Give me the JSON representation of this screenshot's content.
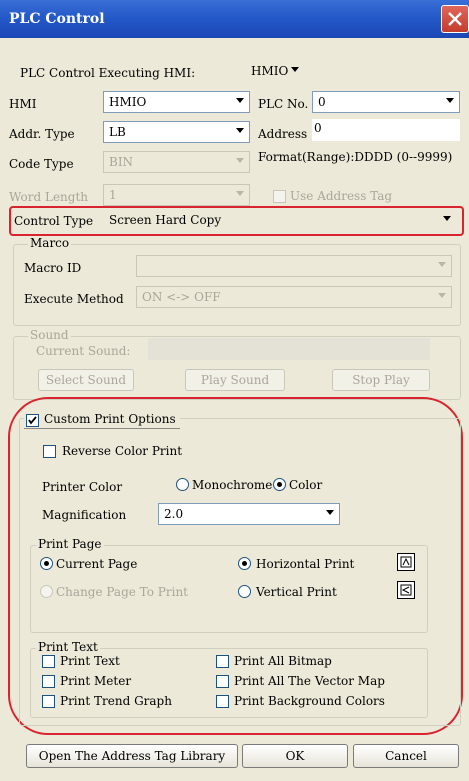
{
  "window": {
    "title": "PLC Control"
  },
  "executing": {
    "label": "PLC Control Executing HMI:",
    "value": "HMIO"
  },
  "hmi": {
    "label": "HMI",
    "value": "HMIO"
  },
  "plc_no": {
    "label": "PLC No.",
    "value": "0"
  },
  "addr_type": {
    "label": "Addr. Type",
    "value": "LB"
  },
  "address": {
    "label": "Address",
    "value": "0"
  },
  "code_type": {
    "label": "Code Type",
    "value": "BIN"
  },
  "format": {
    "text": "Format(Range):DDDD (0--9999)"
  },
  "word_length": {
    "label": "Word Length",
    "value": "1"
  },
  "use_address_tag": {
    "label": "Use Address Tag",
    "checked": false
  },
  "control_type": {
    "label": "Control Type",
    "value": "Screen Hard Copy"
  },
  "marco": {
    "legend": "Marco",
    "macro_id_label": "Macro ID",
    "macro_id_value": "",
    "execute_method_label": "Execute Method",
    "execute_method_value": "ON <-> OFF"
  },
  "sound": {
    "legend": "Sound",
    "current_label": "Current Sound:",
    "select_label": "Select Sound",
    "play_label": "Play Sound",
    "stop_label": "Stop Play"
  },
  "print_options": {
    "label": "Custom Print Options",
    "checked": true,
    "reverse_label": "Reverse Color Print",
    "printer_color_label": "Printer Color",
    "monochrome_label": "Monochrome",
    "color_label": "Color",
    "magnification_label": "Magnification",
    "magnification_value": "2.0"
  },
  "print_page": {
    "legend": "Print Page",
    "current_page": "Current Page",
    "change_page": "Change Page To Print",
    "horizontal": "Horizontal Print",
    "vertical": "Vertical Print"
  },
  "print_text": {
    "legend": "Print Text",
    "items": [
      "Print Text",
      "Print Meter",
      "Print Trend Graph",
      "Print All Bitmap",
      "Print All The Vector Map",
      "Print Background Colors"
    ]
  },
  "footer": {
    "open_lib": "Open The Address Tag Library",
    "ok": "OK",
    "cancel": "Cancel"
  },
  "colors": {
    "title_bar": "#2459c9",
    "annotation": "#d9232e",
    "dialog_bg": "#ece9d8"
  }
}
